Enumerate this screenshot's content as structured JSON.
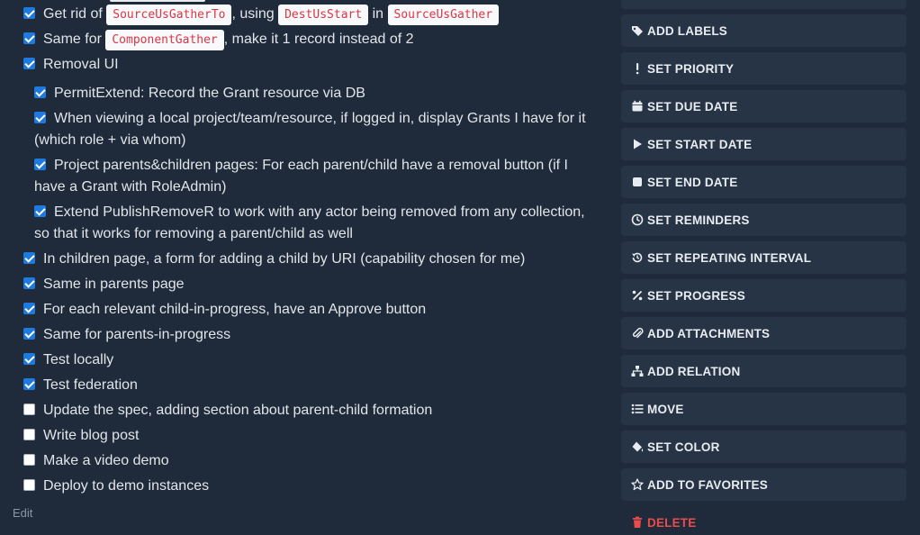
{
  "tasks": [
    {
      "checked": true,
      "parts": [
        {
          "t": "text",
          "v": "Get rid of "
        },
        {
          "t": "code",
          "v": "SourceUsGatherTo"
        },
        {
          "t": "text",
          "v": ", using "
        },
        {
          "t": "code",
          "v": "DestUsStart"
        },
        {
          "t": "text",
          "v": " in "
        },
        {
          "t": "code",
          "v": "SourceUsGather"
        }
      ]
    },
    {
      "checked": true,
      "parts": [
        {
          "t": "text",
          "v": "Same for "
        },
        {
          "t": "code",
          "v": "ComponentGather"
        },
        {
          "t": "text",
          "v": ", make it 1 record instead of 2"
        }
      ]
    },
    {
      "checked": true,
      "parts": [
        {
          "t": "text",
          "v": "Removal UI"
        }
      ]
    },
    {
      "checked": true,
      "sub": true,
      "parts": [
        {
          "t": "text",
          "v": "PermitExtend: Record the Grant resource via DB"
        }
      ]
    },
    {
      "checked": true,
      "sub": true,
      "parts": [
        {
          "t": "text",
          "v": "When viewing a local project/team/resource, if logged in, display Grants I have for it (which role + via whom)"
        }
      ]
    },
    {
      "checked": true,
      "sub": true,
      "parts": [
        {
          "t": "text",
          "v": "Project parents&children pages: For each parent/child have a removal button (if I have a Grant with RoleAdmin)"
        }
      ]
    },
    {
      "checked": true,
      "sub": true,
      "parts": [
        {
          "t": "text",
          "v": "Extend PublishRemoveR to work with any actor being removed from any collection, so that it works for removing a parent/child as well"
        }
      ]
    },
    {
      "checked": true,
      "parts": [
        {
          "t": "text",
          "v": "In children page, a form for adding a child by URI (capability chosen for me)"
        }
      ]
    },
    {
      "checked": true,
      "parts": [
        {
          "t": "text",
          "v": "Same in parents page"
        }
      ]
    },
    {
      "checked": true,
      "parts": [
        {
          "t": "text",
          "v": "For each relevant child-in-progress, have an Approve button"
        }
      ]
    },
    {
      "checked": true,
      "parts": [
        {
          "t": "text",
          "v": "Same for parents-in-progress"
        }
      ]
    },
    {
      "checked": true,
      "parts": [
        {
          "t": "text",
          "v": "Test locally"
        }
      ]
    },
    {
      "checked": true,
      "parts": [
        {
          "t": "text",
          "v": "Test federation"
        }
      ]
    },
    {
      "checked": false,
      "parts": [
        {
          "t": "text",
          "v": "Update the spec, adding section about parent-child formation"
        }
      ]
    },
    {
      "checked": false,
      "parts": [
        {
          "t": "text",
          "v": "Write blog post"
        }
      ]
    },
    {
      "checked": false,
      "parts": [
        {
          "t": "text",
          "v": "Make a video demo"
        }
      ]
    },
    {
      "checked": false,
      "parts": [
        {
          "t": "text",
          "v": "Deploy to demo instances"
        }
      ]
    }
  ],
  "edit_label": "Edit",
  "actions": [
    {
      "label": "Add labels",
      "icon": "tags-icon"
    },
    {
      "label": "Set priority",
      "icon": "exclamation-icon"
    },
    {
      "label": "Set due date",
      "icon": "calendar-icon"
    },
    {
      "label": "Set start date",
      "icon": "play-icon"
    },
    {
      "label": "Set end date",
      "icon": "stop-icon"
    },
    {
      "label": "Set reminders",
      "icon": "clock-icon"
    },
    {
      "label": "Set repeating interval",
      "icon": "history-icon"
    },
    {
      "label": "Set progress",
      "icon": "percent-icon"
    },
    {
      "label": "Add attachments",
      "icon": "paperclip-icon"
    },
    {
      "label": "Add relation",
      "icon": "sitemap-icon"
    },
    {
      "label": "Move",
      "icon": "list-icon"
    },
    {
      "label": "Set color",
      "icon": "fill-drip-icon"
    },
    {
      "label": "Add to favorites",
      "icon": "star-icon"
    },
    {
      "label": "Delete",
      "icon": "trash-icon",
      "danger": true
    }
  ],
  "colors": {
    "background": "#1f2b3b",
    "button_bg": "#263446",
    "checkbox_on": "#1f7ae0",
    "code_text": "#dc3545",
    "danger": "#ea4b4b"
  }
}
